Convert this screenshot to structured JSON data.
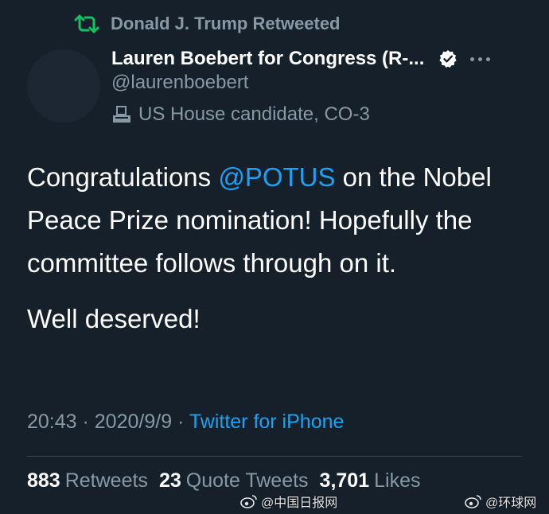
{
  "retweet": {
    "icon": "retweet-icon",
    "text": "Donald J. Trump Retweeted",
    "color": "#17bf63"
  },
  "author": {
    "display_name": "Lauren Boebert for Congress (R-...",
    "handle": "@laurenboebert",
    "verified_icon": "verified-badge-icon",
    "more_icon": "more-options-icon",
    "bio_icon": "ballot-box-icon",
    "bio_label": "US House candidate, CO-3"
  },
  "tweet": {
    "text_before": "Congratulations ",
    "mention": "@POTUS",
    "text_after": " on the Nobel Peace Prize nomination! Hopefully the committee follows through on it.",
    "paragraph2": "Well deserved!"
  },
  "meta": {
    "time": "20:43",
    "separator1": " · ",
    "date": "2020/9/9",
    "separator2": " · ",
    "source": "Twitter for iPhone"
  },
  "stats": {
    "retweets_count": "883",
    "retweets_label": "Retweets",
    "quote_count": "23",
    "quote_label": "Quote Tweets",
    "likes_count": "3,701",
    "likes_label": "Likes"
  },
  "watermarks": {
    "left": "@中国日报网",
    "right": "@环球网"
  },
  "colors": {
    "background": "#15202b",
    "muted": "#8899a6",
    "link": "#1da1f2",
    "text": "#ffffff",
    "divider": "#38444d"
  }
}
